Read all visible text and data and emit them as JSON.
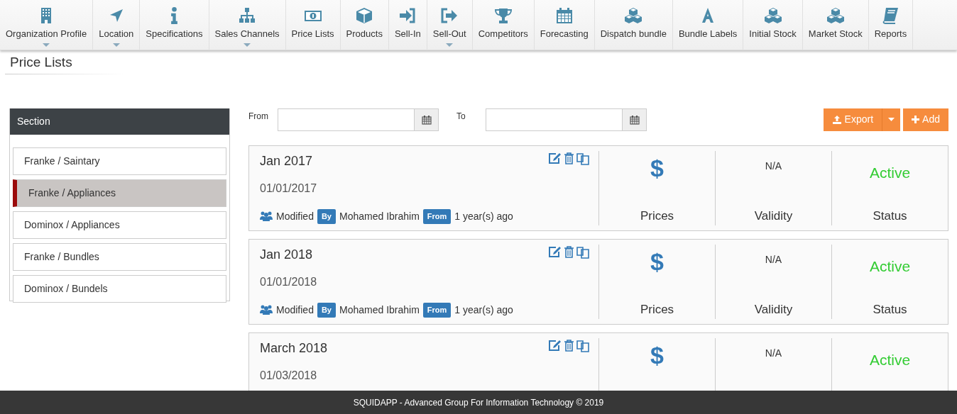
{
  "nav": [
    {
      "label": "Organization Profile",
      "kind": "building",
      "dropdown": true
    },
    {
      "label": "Location",
      "kind": "arrow",
      "dropdown": true
    },
    {
      "label": "Specifications",
      "kind": "info",
      "dropdown": false
    },
    {
      "label": "Sales Channels",
      "kind": "sitemap",
      "dropdown": true
    },
    {
      "label": "Price Lists",
      "kind": "money",
      "dropdown": false
    },
    {
      "label": "Products",
      "kind": "cube",
      "dropdown": false
    },
    {
      "label": "Sell-In",
      "kind": "signin",
      "dropdown": false
    },
    {
      "label": "Sell-Out",
      "kind": "signout",
      "dropdown": true
    },
    {
      "label": "Competitors",
      "kind": "trophy",
      "dropdown": false
    },
    {
      "label": "Forecasting",
      "kind": "calendar",
      "dropdown": false
    },
    {
      "label": "Dispatch bundle",
      "kind": "cubes",
      "dropdown": false
    },
    {
      "label": "Bundle Labels",
      "kind": "letter",
      "dropdown": false
    },
    {
      "label": "Initial Stock",
      "kind": "cubes",
      "dropdown": false
    },
    {
      "label": "Market Stock",
      "kind": "cubes",
      "dropdown": false
    },
    {
      "label": "Reports",
      "kind": "book",
      "dropdown": false
    }
  ],
  "page_title": "Price Lists",
  "sidebar": {
    "header": "Section",
    "items": [
      {
        "label": "Franke / Saintary",
        "selected": false
      },
      {
        "label": "Franke / Appliances",
        "selected": true
      },
      {
        "label": "Dominox / Appliances",
        "selected": false
      },
      {
        "label": "Franke / Bundles",
        "selected": false
      },
      {
        "label": "Dominox / Bundels",
        "selected": false
      }
    ]
  },
  "filters": {
    "from_label": "From",
    "to_label": "To"
  },
  "actions": {
    "export": "Export",
    "add": "Add"
  },
  "price_lists": [
    {
      "title": "Jan 2017",
      "date": "01/01/2017",
      "symbol": "$",
      "validity": "N/A",
      "status": "Active",
      "modified": {
        "text": "Modified",
        "by_badge": "By",
        "user": "Mohamed Ibrahim",
        "from_badge": "From",
        "ago": "1 year(s) ago"
      },
      "labels": {
        "prices": "Prices",
        "validity": "Validity",
        "status": "Status"
      }
    },
    {
      "title": "Jan 2018",
      "date": "01/01/2018",
      "symbol": "$",
      "validity": "N/A",
      "status": "Active",
      "modified": {
        "text": "Modified",
        "by_badge": "By",
        "user": "Mohamed Ibrahim",
        "from_badge": "From",
        "ago": "1 year(s) ago"
      },
      "labels": {
        "prices": "Prices",
        "validity": "Validity",
        "status": "Status"
      }
    },
    {
      "title": "March 2018",
      "date": "01/03/2018",
      "symbol": "$",
      "validity": "N/A",
      "status": "Active"
    }
  ],
  "footer": "SQUIDAPP - Advanced Group For Information Technology © 2019"
}
